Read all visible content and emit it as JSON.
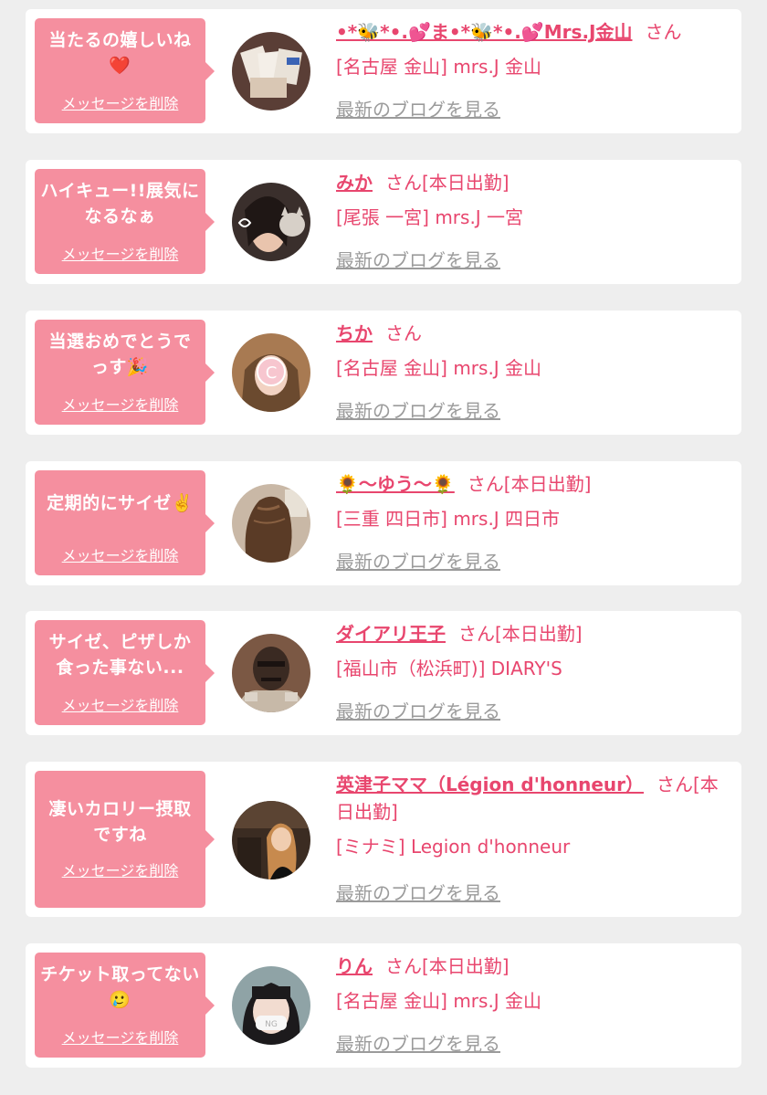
{
  "common": {
    "delete_label": "メッセージを削除",
    "blog_label": "最新のブログを見る",
    "san_label": "さん",
    "accent_color": "#e8466e",
    "bubble_color": "#f58f9f"
  },
  "messages": [
    {
      "message": "当たるの嬉しいね❤️",
      "name": "•*🐝*•.💕ま•*🐝*•.💕Mrs.J金山",
      "name_suffix": "さん",
      "shop": "[名古屋 金山] mrs.J 金山",
      "avatar_icon": "tickets-photo-avatar"
    },
    {
      "message": "ハイキュー!!展気になるなぁ",
      "name": "みか",
      "name_suffix": "さん[本日出勤]",
      "shop": "[尾張 一宮] mrs.J 一宮",
      "avatar_icon": "woman-with-cat-photo-avatar"
    },
    {
      "message": "当選おめでとうでっす🎉",
      "name": "ちか",
      "name_suffix": "さん",
      "shop": "[名古屋 金山] mrs.J 金山",
      "avatar_icon": "woman-hidden-face-photo-avatar"
    },
    {
      "message": "定期的にサイゼ✌️",
      "name": "🌻〜ゆう〜🌻",
      "name_suffix": "さん[本日出勤]",
      "shop": "[三重 四日市] mrs.J 四日市",
      "avatar_icon": "hair-back-photo-avatar"
    },
    {
      "message": "サイゼ、ピザしか食った事ない...",
      "name": "ダイアリ王子",
      "name_suffix": "さん[本日出勤]",
      "shop": "[福山市（松浜町)] DIARY'S",
      "avatar_icon": "costumed-man-photo-avatar"
    },
    {
      "message": "凄いカロリー摂取ですね",
      "name": "英津子ママ（Légion d'honneur）",
      "name_suffix": "さん[本日出勤]",
      "shop": "[ミナミ] Legion d'honneur",
      "avatar_icon": "woman-in-bar-photo-avatar"
    },
    {
      "message": "チケット取ってない🥲",
      "name": "りん",
      "name_suffix": "さん[本日出勤]",
      "shop": "[名古屋 金山] mrs.J 金山",
      "avatar_icon": "woman-with-mask-photo-avatar"
    }
  ]
}
